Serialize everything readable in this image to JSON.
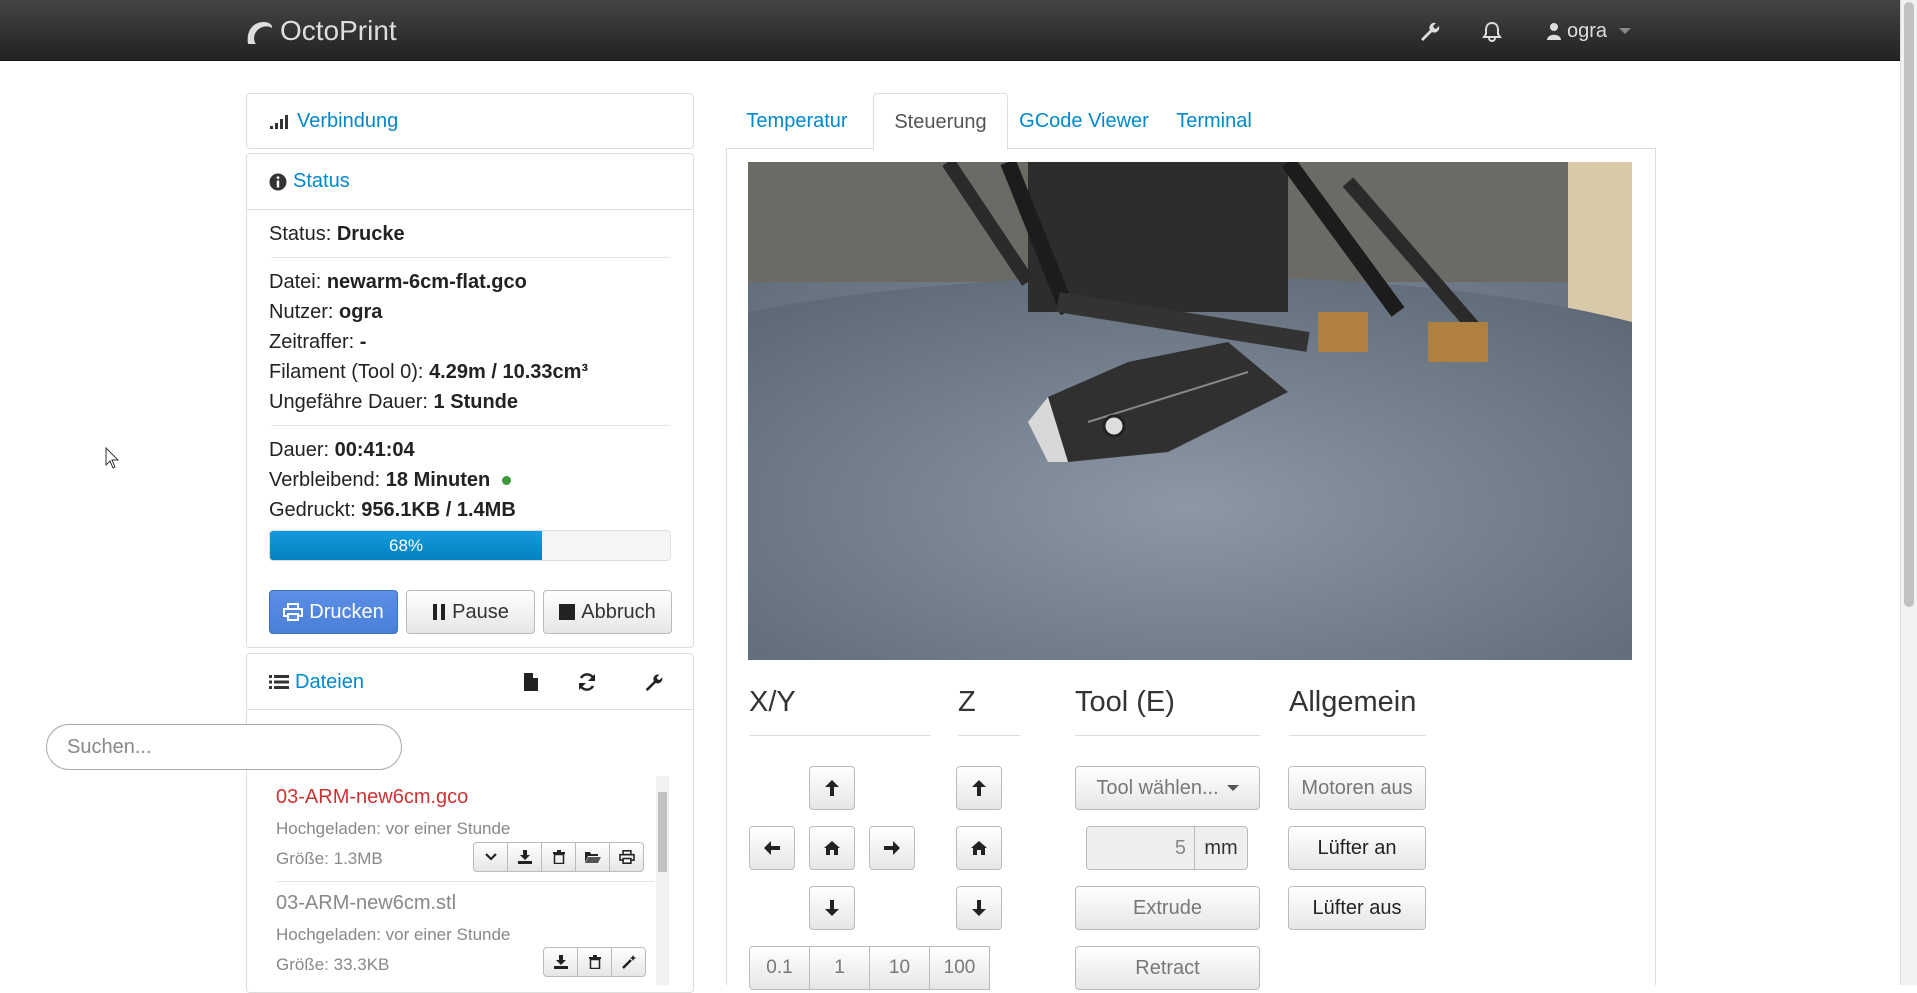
{
  "navbar": {
    "brand": "OctoPrint",
    "user": "ogra"
  },
  "connection": {
    "title": "Verbindung"
  },
  "status": {
    "title": "Status",
    "state_label": "Status:",
    "state_value": "Drucke",
    "file_label": "Datei:",
    "file_value": "newarm-6cm-flat.gco",
    "user_label": "Nutzer:",
    "user_value": "ogra",
    "timelapse_label": "Zeitraffer:",
    "timelapse_value": "-",
    "filament_label": "Filament (Tool 0):",
    "filament_value": "4.29m / 10.33cm³",
    "approx_label": "Ungefähre Dauer:",
    "approx_value": "1 Stunde",
    "duration_label": "Dauer:",
    "duration_value": "00:41:04",
    "remaining_label": "Verbleibend:",
    "remaining_value": "18 Minuten",
    "printed_label": "Gedruckt:",
    "printed_value": "956.1KB / 1.4MB",
    "progress_text": "68%",
    "progress_fraction": 0.68,
    "btn_print": "Drucken",
    "btn_pause": "Pause",
    "btn_cancel": "Abbruch"
  },
  "files": {
    "title": "Dateien",
    "search_placeholder": "Suchen...",
    "items": [
      {
        "name": "03-ARM-new6cm.gco",
        "uploaded": "Hochgeladen: vor einer Stunde",
        "size": "Größe: 1.3MB"
      },
      {
        "name": "03-ARM-new6cm.stl",
        "uploaded": "Hochgeladen: vor einer Stunde",
        "size": "Größe: 33.3KB"
      }
    ]
  },
  "tabs": [
    "Temperatur",
    "Steuerung",
    "GCode Viewer",
    "Terminal"
  ],
  "control": {
    "xy_title": "X/Y",
    "z_title": "Z",
    "tool_title": "Tool (E)",
    "general_title": "Allgemein",
    "steps": [
      "0.1",
      "1",
      "10",
      "100"
    ],
    "tool_select": "Tool wählen...",
    "extrude_amount": "5",
    "unit": "mm",
    "extrude": "Extrude",
    "retract": "Retract",
    "motors_off": "Motoren aus",
    "fan_on": "Lüfter an",
    "fan_off": "Lüfter aus"
  },
  "colors": {
    "accent": "#0088cc",
    "active_file": "#cc3333",
    "progress": "#0e90d2",
    "primary_btn": "#4f84db",
    "online_dot": "#3c9a3c"
  }
}
